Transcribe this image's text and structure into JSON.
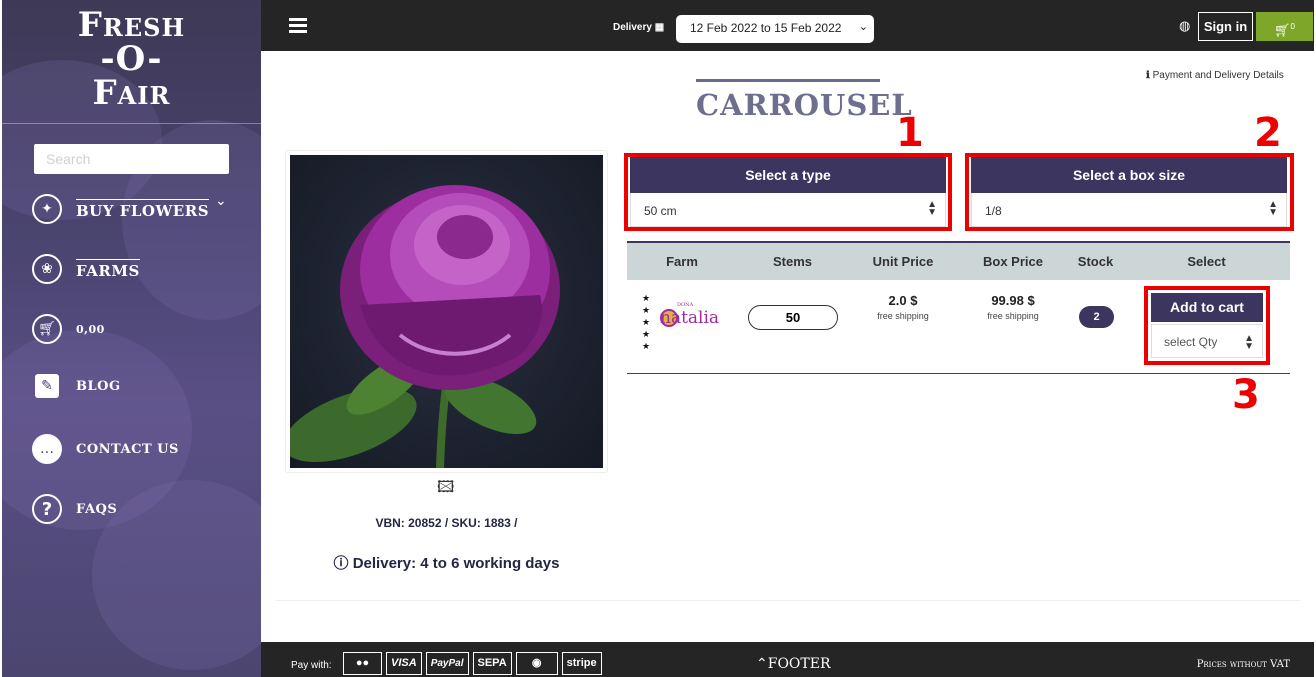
{
  "brand": {
    "line1": "Fresh",
    "line2": "-O-",
    "line3": "Fair"
  },
  "sidebar": {
    "search_placeholder": "Search",
    "items": [
      {
        "label": "BUY FLOWERS",
        "icon": "flower-swirl-icon"
      },
      {
        "label": "FARMS",
        "icon": "rose-icon"
      },
      {
        "label": "0,00",
        "icon": "cart-icon"
      },
      {
        "label": "BLOG",
        "icon": "pencil-icon"
      },
      {
        "label": "CONTACT US",
        "icon": "chat-icon"
      },
      {
        "label": "FAQS",
        "icon": "question-icon"
      }
    ]
  },
  "topbar": {
    "delivery_label": "Delivery",
    "delivery_range": "12 Feb 2022 to 15 Feb 2022",
    "signin_label": "Sign in",
    "cart_count": "0"
  },
  "product": {
    "title": "CARROUSEL",
    "payment_link": "Payment and Delivery Details",
    "vbn_sku": "VBN: 20852 / SKU: 1883 /",
    "delivery_time": "Delivery: 4 to 6 working days"
  },
  "selectors": {
    "type_label": "Select a type",
    "type_value": "50 cm",
    "box_label": "Select a box size",
    "box_value": "1/8"
  },
  "annotations": [
    "1",
    "2",
    "3"
  ],
  "table": {
    "headers": [
      "Farm",
      "Stems",
      "Unit Price",
      "Box Price",
      "Stock",
      "Select"
    ],
    "row": {
      "farm_name": "natalia",
      "farm_prefix": "DOÑA",
      "stars": "★ ★ ★ ★ ★",
      "stems": "50",
      "unit_price": "2.0 $",
      "unit_note": "free shipping",
      "box_price": "99.98 $",
      "box_note": "free shipping",
      "stock": "2",
      "add_label": "Add to cart",
      "qty_placeholder": "select Qty"
    }
  },
  "footer": {
    "pay_with": "Pay with:",
    "pay_methods": [
      "VISA",
      "PayPal",
      "SEPA",
      "stripe"
    ],
    "title": "FOOTER",
    "prices_note": "Prices without VAT"
  },
  "colors": {
    "sidebar": "#4a4470",
    "accent": "#3b3560",
    "cart": "#7ea628",
    "annotation": "#ee0000"
  }
}
